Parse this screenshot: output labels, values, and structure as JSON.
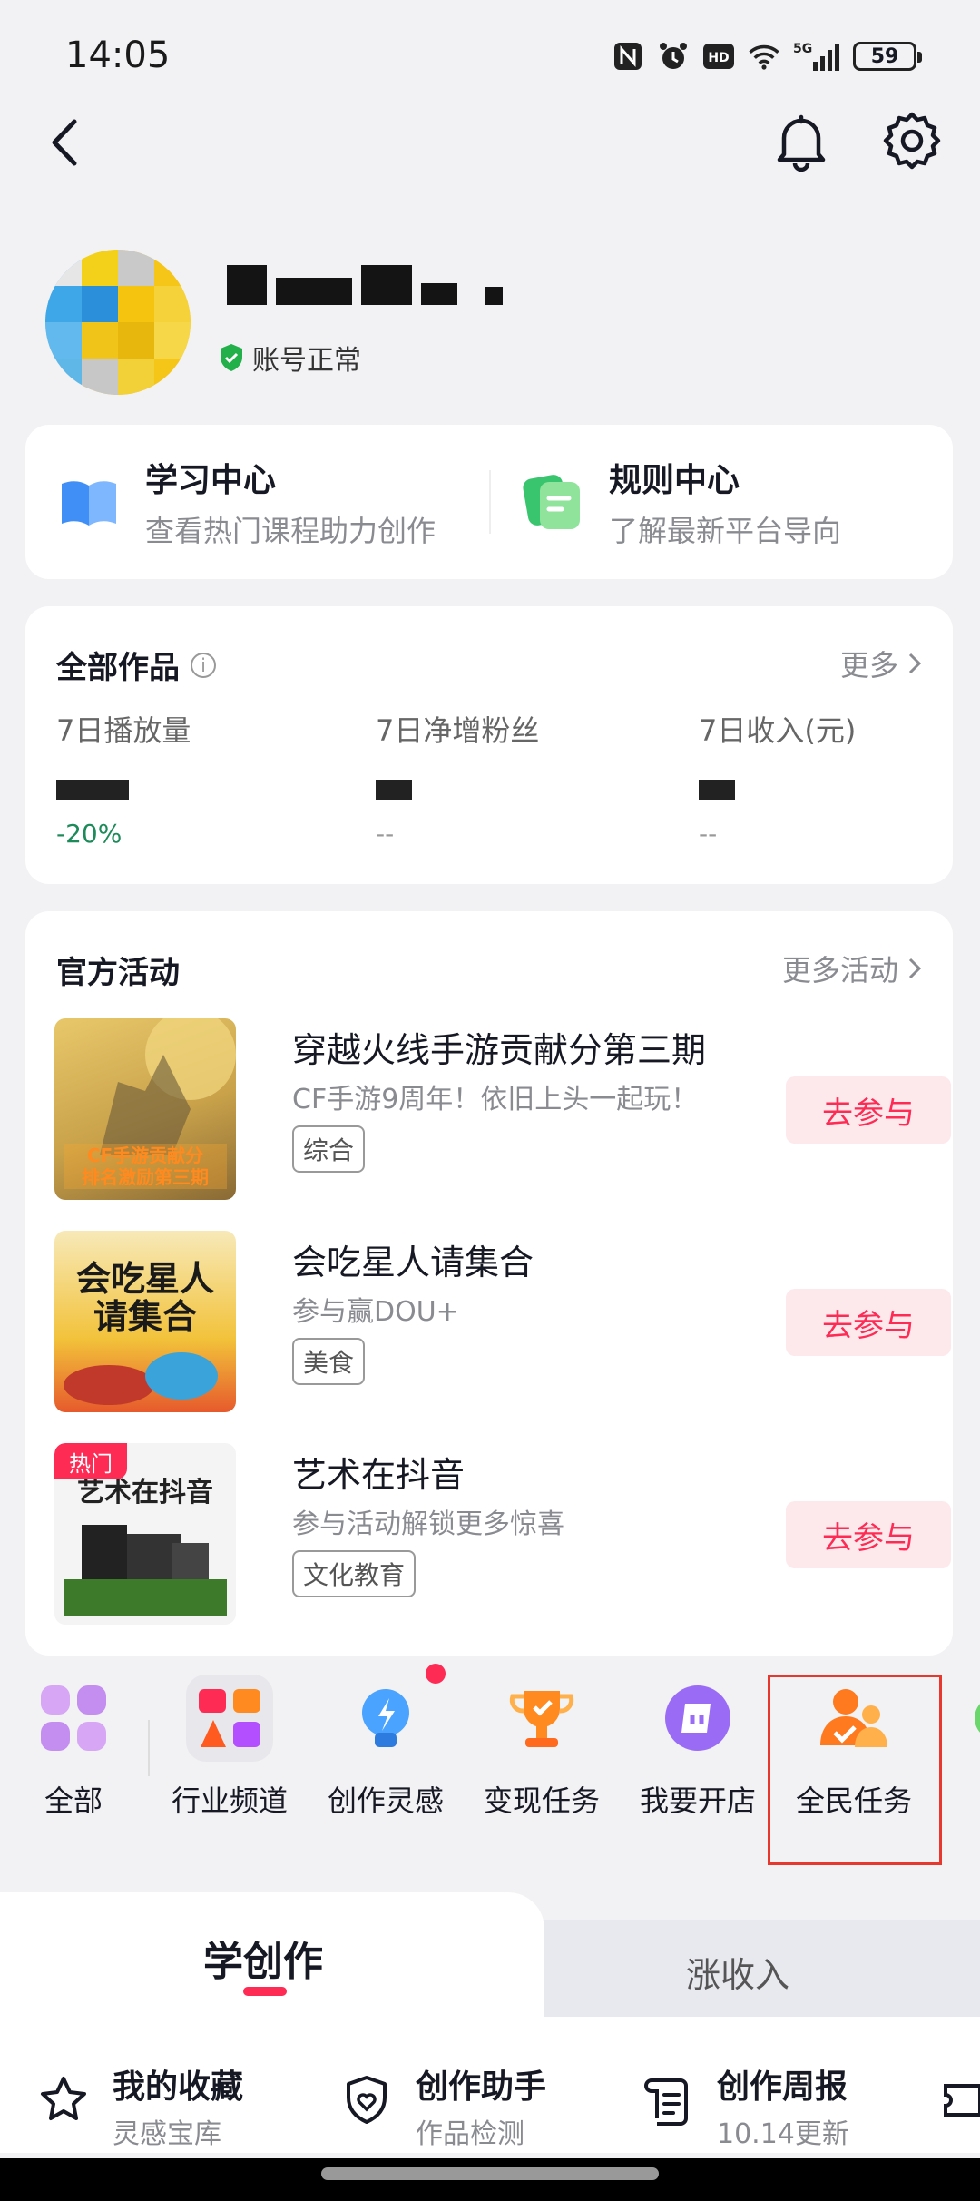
{
  "status_bar": {
    "time": "14:05",
    "network": "5G",
    "battery": "59"
  },
  "profile": {
    "account_status": "账号正常"
  },
  "learn": [
    {
      "title": "学习中心",
      "subtitle": "查看热门课程助力创作"
    },
    {
      "title": "规则中心",
      "subtitle": "了解最新平台导向"
    }
  ],
  "works": {
    "title": "全部作品",
    "more": "更多",
    "stats": [
      {
        "label": "7日播放量",
        "value": "",
        "change": "-20%"
      },
      {
        "label": "7日净增粉丝",
        "value": "",
        "change": "--"
      },
      {
        "label": "7日收入(元)",
        "value": "",
        "change": "--"
      }
    ]
  },
  "activities": {
    "title": "官方活动",
    "more": "更多活动",
    "items": [
      {
        "name": "穿越火线手游贡献分第三期",
        "desc": "CF手游9周年！依旧上头一起玩！",
        "tag": "综合",
        "button": "去参与",
        "image_text": "CF手游贡献分\n排名激励第三期"
      },
      {
        "name": "会吃星人请集合",
        "desc": "参与赢DOU+",
        "tag": "美食",
        "button": "去参与",
        "image_text": "会吃星人\n请集合"
      },
      {
        "name": "艺术在抖音",
        "desc": "参与活动解锁更多惊喜",
        "tag": "文化教育",
        "button": "去参与",
        "image_text": "艺术在抖音",
        "badge": "热门"
      }
    ]
  },
  "tools": [
    {
      "label": "全部",
      "icon": "grid-icon"
    },
    {
      "label": "行业频道",
      "icon": "industry-icon"
    },
    {
      "label": "创作灵感",
      "icon": "lightbulb-icon"
    },
    {
      "label": "变现任务",
      "icon": "trophy-icon"
    },
    {
      "label": "我要开店",
      "icon": "shop-icon"
    },
    {
      "label": "全民任务",
      "icon": "people-task-icon"
    }
  ],
  "bottom_tabs": {
    "active": "学创作",
    "inactive": "涨收入"
  },
  "shortcuts": [
    {
      "title": "我的收藏",
      "subtitle": "灵感宝库",
      "icon": "star-icon"
    },
    {
      "title": "创作助手",
      "subtitle": "作品检测",
      "icon": "shield-heart-icon"
    },
    {
      "title": "创作周报",
      "subtitle": "10.14更新",
      "icon": "report-icon"
    }
  ],
  "colors": {
    "accent": "#fe2c55",
    "background": "#f2f2f5",
    "card": "#ffffff",
    "positive": "#1d8a5a"
  }
}
